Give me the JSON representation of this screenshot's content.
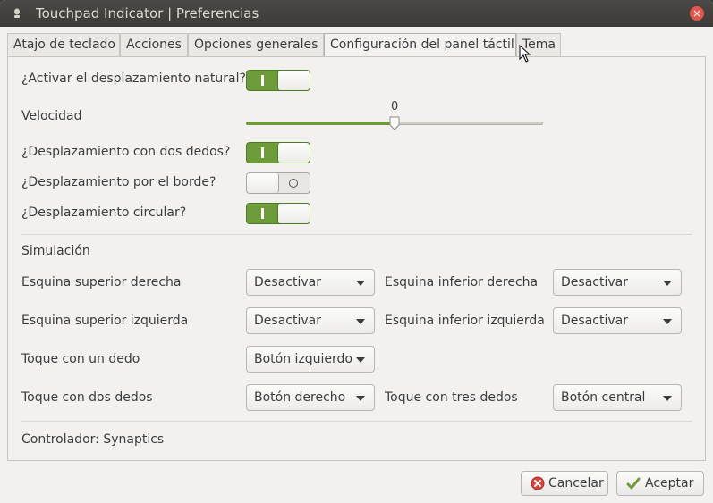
{
  "window": {
    "title": "Touchpad Indicator | Preferencias",
    "close_glyph": "×"
  },
  "tabs": [
    {
      "label": "Atajo de teclado"
    },
    {
      "label": "Acciones"
    },
    {
      "label": "Opciones generales"
    },
    {
      "label": "Configuración del panel táctil",
      "active": true
    },
    {
      "label": "Tema"
    }
  ],
  "settings": {
    "natural_scroll": {
      "label": "¿Activar el desplazamiento natural?",
      "state": "on"
    },
    "speed": {
      "label": "Velocidad",
      "value": "0",
      "fraction": 0.5
    },
    "two_finger": {
      "label": "¿Desplazamiento con dos dedos?",
      "state": "on"
    },
    "edge": {
      "label": "¿Desplazamiento por el borde?",
      "state": "off"
    },
    "circular": {
      "label": "¿Desplazamiento circular?",
      "state": "on"
    }
  },
  "simulation": {
    "heading": "Simulación",
    "top_right": {
      "label": "Esquina superior derecha",
      "value": "Desactivar"
    },
    "bottom_right": {
      "label": "Esquina inferior derecha",
      "value": "Desactivar"
    },
    "top_left": {
      "label": "Esquina superior izquierda",
      "value": "Desactivar"
    },
    "bottom_left": {
      "label": "Esquina inferior izquierda",
      "value": "Desactivar"
    },
    "one_finger": {
      "label": "Toque con un dedo",
      "value": "Botón izquierdo"
    },
    "two_fingers": {
      "label": "Toque con dos dedos",
      "value": "Botón derecho"
    },
    "three_fingers": {
      "label": "Toque con tres dedos",
      "value": "Botón central"
    }
  },
  "driver": {
    "label": "Controlador: Synaptics"
  },
  "buttons": {
    "cancel": "Cancelar",
    "accept": "Aceptar"
  },
  "colors": {
    "accent": "#6d9b3a",
    "titlebar": "#3c3b37",
    "close": "#e2574c"
  },
  "icons": {
    "cancel": "cancel-circle-icon",
    "accept": "checkmark-icon",
    "app": "touchpad-app-icon"
  }
}
